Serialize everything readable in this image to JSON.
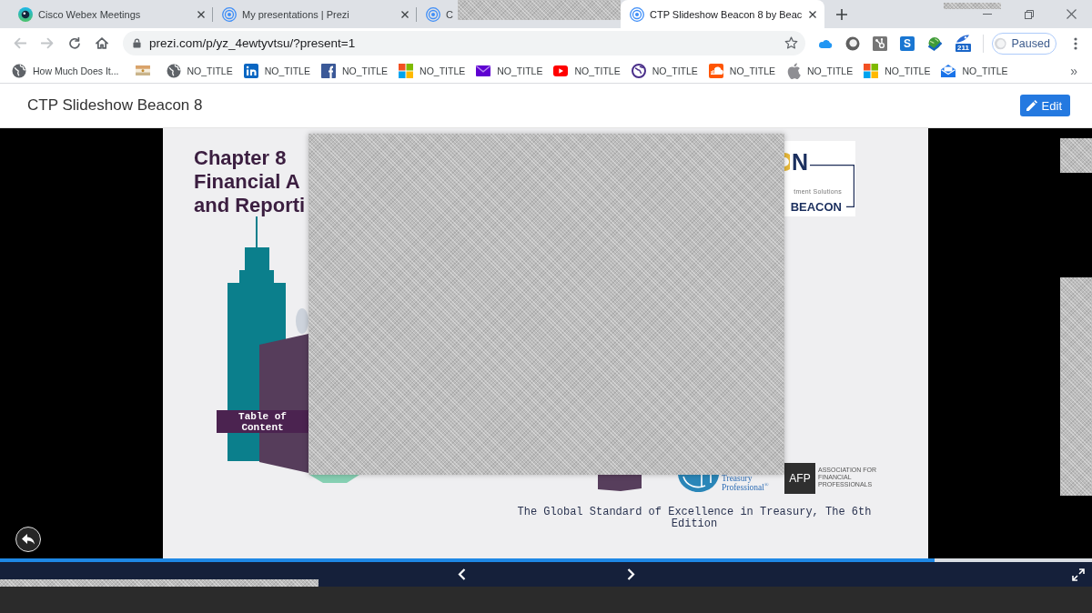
{
  "tabs": [
    {
      "kind": "webex",
      "title": "Cisco Webex Meetings",
      "selected": false,
      "obscured": false
    },
    {
      "kind": "prezi",
      "title": "My presentations | Prezi",
      "selected": false,
      "obscured": false
    },
    {
      "kind": "prezi",
      "title": "C",
      "selected": false,
      "obscured": true
    },
    {
      "kind": "prezi",
      "title": "CTP Slideshow Beacon 8 by Beac",
      "selected": true,
      "obscured": false
    }
  ],
  "toolbar": {
    "nav_buttons": [
      {
        "kind": "back",
        "disabled": true
      },
      {
        "kind": "forward",
        "disabled": true
      },
      {
        "kind": "reload",
        "disabled": false
      },
      {
        "kind": "home",
        "disabled": false
      }
    ],
    "url": "prezi.com/p/yz_4ewtyvtsu/?present=1",
    "extensions": [
      {
        "kind": "cloud"
      },
      {
        "kind": "ring"
      },
      {
        "kind": "hub"
      },
      {
        "kind": "letter",
        "label": "S"
      },
      {
        "kind": "globe"
      },
      {
        "kind": "badge",
        "label": "211"
      }
    ],
    "profile": {
      "label": "Paused"
    }
  },
  "bookmarks": {
    "items": [
      {
        "kind": "globe",
        "label": "How Much Does It..."
      },
      {
        "kind": "flag"
      },
      {
        "kind": "globe",
        "label": "NO_TITLE"
      },
      {
        "kind": "in-tile",
        "label": "NO_TITLE"
      },
      {
        "kind": "f-tile",
        "label": "NO_TITLE"
      },
      {
        "kind": "squares",
        "label": "NO_TITLE"
      },
      {
        "kind": "envelope",
        "label": "NO_TITLE"
      },
      {
        "kind": "play",
        "label": "NO_TITLE"
      },
      {
        "kind": "world",
        "label": "NO_TITLE"
      },
      {
        "kind": "cloud",
        "label": "NO_TITLE"
      },
      {
        "kind": "apple",
        "label": "NO_TITLE"
      },
      {
        "kind": "squares",
        "label": "NO_TITLE"
      },
      {
        "kind": "mailbox",
        "label": "NO_TITLE"
      }
    ],
    "overflow": "»"
  },
  "presentation": {
    "title": "CTP Slideshow Beacon 8",
    "edit_button": "Edit"
  },
  "slide": {
    "title_lines": [
      "Chapter 8",
      "Financial A",
      "and Reporti"
    ],
    "toc_label": "Table of Content",
    "beacon_logo": {
      "fragment": "N",
      "tagline": "tment Solutions",
      "wordmark": "BEACON"
    },
    "ctp_logo": "Treasury Professional$^{®}$",
    "afp_logo": {
      "mark": "AFP",
      "name": "ASSOCIATION FOR FINANCIAL PROFESSIONALS"
    },
    "caption": "The Global Standard of Excellence in Treasury, The 6th Edition"
  },
  "progress": {
    "level": 0.856
  }
}
